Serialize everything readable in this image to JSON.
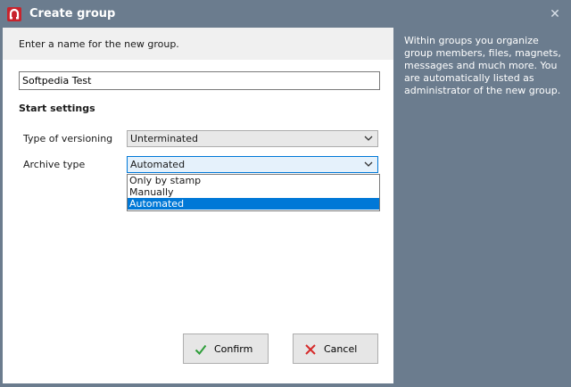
{
  "window": {
    "title": "Create group",
    "close_glyph": "✕",
    "icon": "magnet-icon"
  },
  "form": {
    "prompt": "Enter a name for the new group.",
    "name_value": "Softpedia Test",
    "section_title": "Start settings",
    "versioning": {
      "label": "Type of versioning",
      "value": "Unterminated"
    },
    "archive": {
      "label": "Archive type",
      "value": "Automated",
      "options": [
        "Only by stamp",
        "Manually",
        "Automated"
      ],
      "selected_index": 2
    }
  },
  "buttons": {
    "confirm": "Confirm",
    "cancel": "Cancel"
  },
  "info_text": "Within groups you organize group members, files, magnets, messages and much more. You are automatically listed as administrator of the new group.",
  "colors": {
    "chrome": "#6b7c8e",
    "accent": "#0078d7",
    "confirm_icon": "#2e9e3a",
    "cancel_icon": "#d62a2a"
  }
}
